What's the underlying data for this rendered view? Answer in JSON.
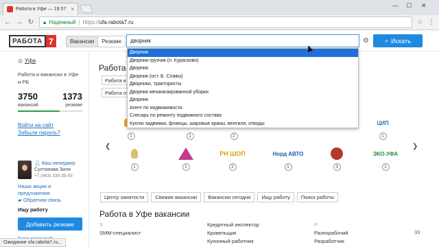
{
  "browser": {
    "tab_title": "Работа в Уфе — 19 57",
    "tab_close": "×",
    "secure_label": "Надежный",
    "url_scheme": "https://",
    "url_host": "ufa.rabota7.ru",
    "back": "←",
    "forward": "→",
    "reload": "↻",
    "star": "☆",
    "menu": "⋮",
    "minimize": "—",
    "maximize": "☐",
    "close": "✕"
  },
  "header": {
    "logo_word": "РАБОТА",
    "logo_num": "7",
    "seg_vacancies": "Вакансии",
    "seg_resume": "Резюме",
    "search_value": "дворник",
    "settings_icon": "⚙",
    "search_button": "Искать",
    "search_icon": "⌕"
  },
  "autocomplete": [
    "Дворник",
    "Дворник-грузчик (п. Курасково)",
    "Дворник.",
    "Дворник (ост. Б. Славы)",
    "Дворники, трактористы",
    "Дворник механизированной уборки",
    "Дворник",
    "Агент по недвижимости",
    "Слесарь по ремонту подвижного состава",
    "Куплю задвижки, фланцы, шаровые краны, вентиля, отводы"
  ],
  "sidebar": {
    "city": "Уфа",
    "blurb": "Работа и вакансии в Уфе и РБ",
    "vacancies_count": "3750",
    "vacancies_label": "вакансий",
    "resume_count": "1373",
    "resume_label": "резюме",
    "login": "Войти на сайт",
    "forgot": "Забыли пароль?",
    "manager_title": "Ваш менеджер",
    "manager_name": "Султанова Зиля",
    "manager_phone": "+7 (963) 235-35-55",
    "promo": "Наши акции и предложения",
    "feedback": "Обратная связь",
    "job_search": "Ищу работу",
    "add_resume": "Добавить резюме",
    "base_link": "База вакансий"
  },
  "main": {
    "heading": "Работа",
    "chips": [
      "Работа в",
      "Работа от"
    ],
    "logos": [
      {
        "label": "",
        "count": "1"
      },
      {
        "label": "",
        "count": "1"
      },
      {
        "label": "",
        "count": "2"
      },
      {
        "label": "ЦИП",
        "count": "1"
      },
      {
        "label": "",
        "count": "1"
      },
      {
        "label": "",
        "count": "1"
      },
      {
        "label": "РН ШОП",
        "count": "2"
      },
      {
        "label": "Норд АВТО",
        "count": "1"
      },
      {
        "label": "",
        "count": "3"
      },
      {
        "label": "ЭКО-УФА",
        "count": "1"
      }
    ],
    "tabs": [
      "Центр занятости",
      "Свежие вакансии",
      "Вакансии сегодня",
      "Ищу работу",
      "Поиск работы"
    ],
    "vac_heading": "Работа в Уфе вакансии",
    "col1_letter": "S",
    "col1_item": "SMM-специалист",
    "col2": [
      "Кредитный инспектор",
      "Кровельщик",
      "Кухонный работник"
    ],
    "col3_letter": "P",
    "col3": [
      "Разнорабочий",
      "Разработчик"
    ],
    "col3_count": "33"
  },
  "status_bar": "Ожидание ufa.rabota7.ru..."
}
